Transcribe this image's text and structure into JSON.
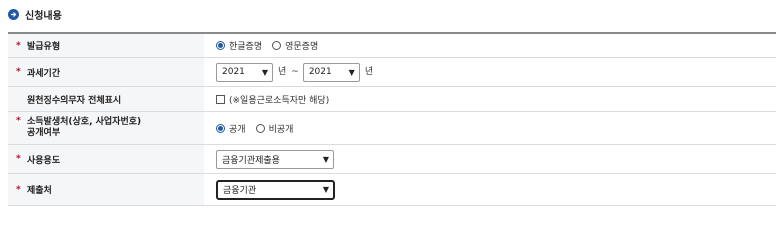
{
  "section": {
    "title": "신청내용"
  },
  "rows": {
    "issue_type": {
      "label": "발급유형",
      "options": [
        "한글증명",
        "영문증명"
      ],
      "selected": "한글증명"
    },
    "tax_period": {
      "label": "과세기간",
      "start_year": "2021",
      "start_suffix": "년",
      "separator": "~",
      "end_year": "2021",
      "end_suffix": "년"
    },
    "withholding": {
      "label": "원천징수의무자 전체표시",
      "checkbox_text": "(※일용근로소득자만 해당)"
    },
    "income_source": {
      "label_line1": "소득발생처(상호, 사업자번호)",
      "label_line2": "공개여부",
      "options": [
        "공개",
        "비공개"
      ],
      "selected": "공개"
    },
    "usage": {
      "label": "사용용도",
      "value": "금융기관제출용"
    },
    "submit_to": {
      "label": "제출처",
      "value": "금융기관"
    }
  },
  "colors": {
    "required": "#d0021b",
    "accent": "#1e5aa8"
  }
}
